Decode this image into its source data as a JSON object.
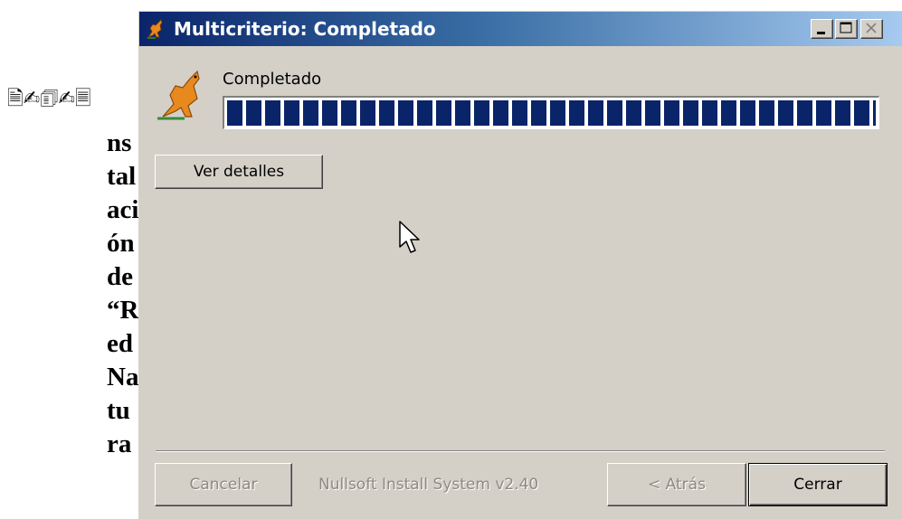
{
  "document": {
    "glyphs": "🗎✍🗊✍🗏",
    "lines": [
      "ns",
      "tal",
      "aci",
      "ón",
      "de",
      "“R",
      "ed",
      "Na",
      "tu",
      "ra"
    ]
  },
  "window": {
    "title": "Multicriterio: Completado",
    "title_icon": "kangaroo-icon",
    "controls": [
      "minimize",
      "maximize",
      "close"
    ]
  },
  "progress": {
    "label": "Completado",
    "fraction": 1.0,
    "bar_color": "#0a246a"
  },
  "buttons": {
    "details": "Ver detalles",
    "cancel": "Cancelar",
    "back": "< Atrás",
    "close": "Cerrar"
  },
  "branding": "Nullsoft Install System v2.40",
  "colors": {
    "dialog_bg": "#d4d0c8",
    "title_start": "#0a246a",
    "title_end": "#a6caf0"
  }
}
